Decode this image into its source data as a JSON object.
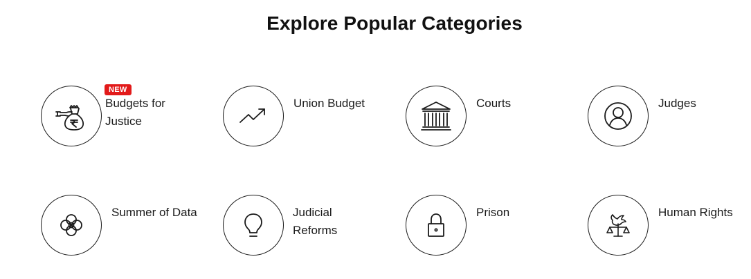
{
  "section": {
    "title": "Explore Popular Categories"
  },
  "categories": [
    {
      "label": "Budgets for\nJustice",
      "badge": "NEW",
      "icon": "money-bag-rupee-icon"
    },
    {
      "label": "Union Budget",
      "icon": "trending-up-icon"
    },
    {
      "label": "Courts",
      "icon": "courthouse-icon"
    },
    {
      "label": "Judges",
      "icon": "person-icon"
    },
    {
      "label": "Summer of Data",
      "icon": "flower-icon"
    },
    {
      "label": "Judicial\nReforms",
      "icon": "lightbulb-icon"
    },
    {
      "label": "Prison",
      "icon": "padlock-icon"
    },
    {
      "label": "Human Rights",
      "icon": "dove-scales-icon"
    }
  ]
}
